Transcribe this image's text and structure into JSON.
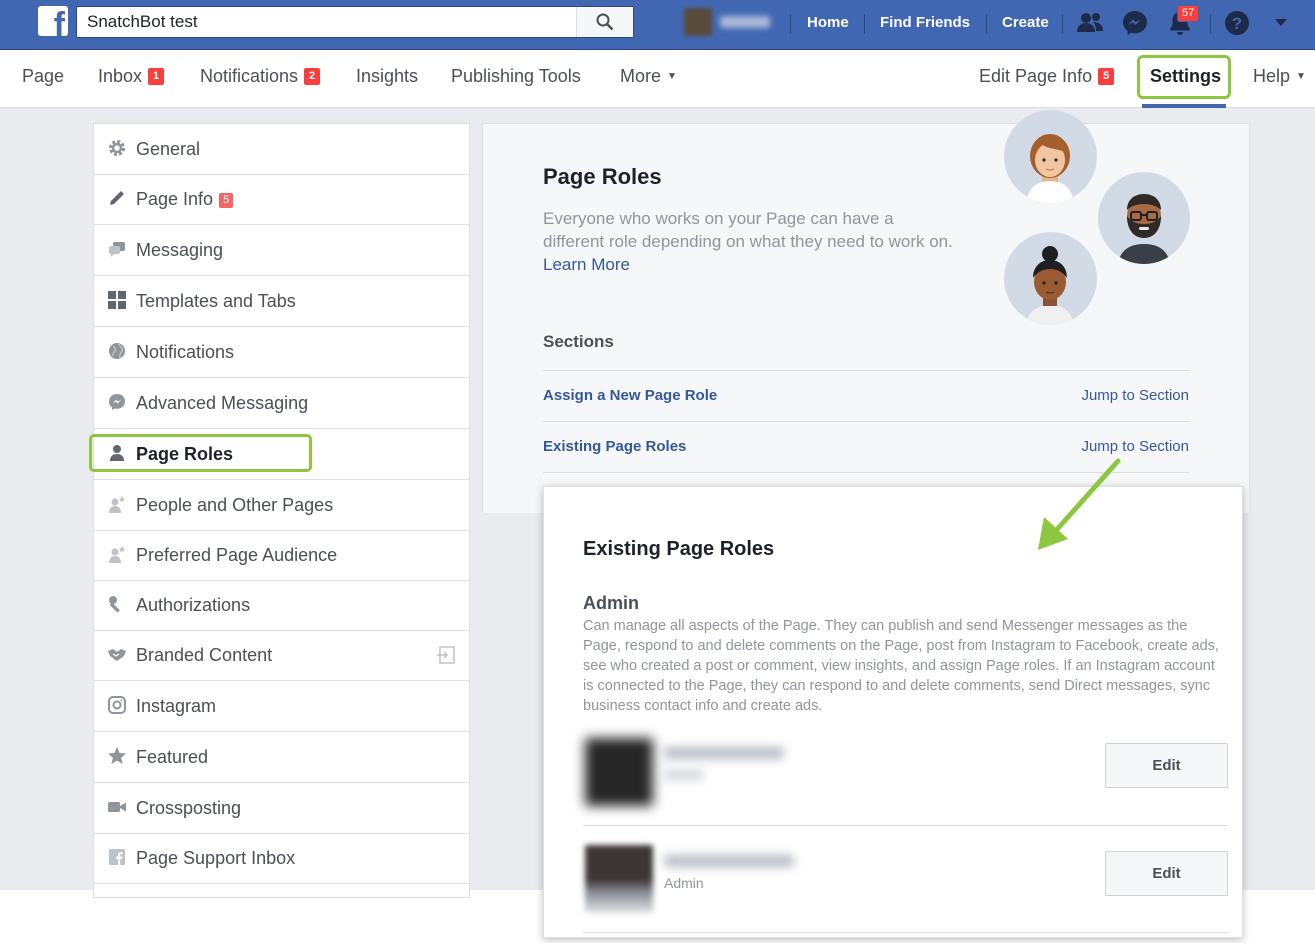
{
  "topbar": {
    "search_value": "SnatchBot test",
    "nav": [
      "Home",
      "Find Friends",
      "Create"
    ],
    "notifications_badge": "57",
    "brand_color": "#4267b2"
  },
  "subnav": {
    "left": [
      {
        "label": "Page"
      },
      {
        "label": "Inbox",
        "badge": "1"
      },
      {
        "label": "Notifications",
        "badge": "2"
      },
      {
        "label": "Insights"
      },
      {
        "label": "Publishing Tools"
      },
      {
        "label": "More"
      }
    ],
    "right": [
      {
        "label": "Edit Page Info",
        "badge": "5"
      },
      {
        "label": "Settings"
      },
      {
        "label": "Help"
      }
    ]
  },
  "sidebar": {
    "items": [
      {
        "label": "General",
        "icon": "gear-icon"
      },
      {
        "label": "Page Info",
        "icon": "pencil-icon",
        "badge": "5"
      },
      {
        "label": "Messaging",
        "icon": "chat-bubbles-icon"
      },
      {
        "label": "Templates and Tabs",
        "icon": "grid-icon"
      },
      {
        "label": "Notifications",
        "icon": "globe-icon"
      },
      {
        "label": "Advanced Messaging",
        "icon": "messenger-icon"
      },
      {
        "label": "Page Roles",
        "icon": "person-icon"
      },
      {
        "label": "People and Other Pages",
        "icon": "person-star-icon"
      },
      {
        "label": "Preferred Page Audience",
        "icon": "person-star-icon"
      },
      {
        "label": "Authorizations",
        "icon": "wrench-icon"
      },
      {
        "label": "Branded Content",
        "icon": "handshake-icon"
      },
      {
        "label": "Instagram",
        "icon": "instagram-icon"
      },
      {
        "label": "Featured",
        "icon": "star-icon"
      },
      {
        "label": "Crossposting",
        "icon": "video-camera-icon"
      },
      {
        "label": "Page Support Inbox",
        "icon": "facebook-icon"
      }
    ]
  },
  "main": {
    "title": "Page Roles",
    "description": "Everyone who works on your Page can have a different role depending on what they need to work on.",
    "learn_more": "Learn More",
    "sections_title": "Sections",
    "sections": [
      {
        "label": "Assign a New Page Role",
        "jump": "Jump to Section"
      },
      {
        "label": "Existing Page Roles",
        "jump": "Jump to Section"
      }
    ]
  },
  "card": {
    "title": "Existing Page Roles",
    "admin_title": "Admin",
    "admin_description": "Can manage all aspects of the Page. They can publish and send Messenger messages as the Page, respond to and delete comments on the Page, post from Instagram to Facebook, create ads, see who created a post or comment, view insights, and assign Page roles. If an Instagram account is connected to the Page, they can respond to and delete comments, send Direct messages, sync business contact info and create ads.",
    "edit_label": "Edit",
    "role_label": "Admin"
  },
  "highlight_color": "#8dc63f"
}
